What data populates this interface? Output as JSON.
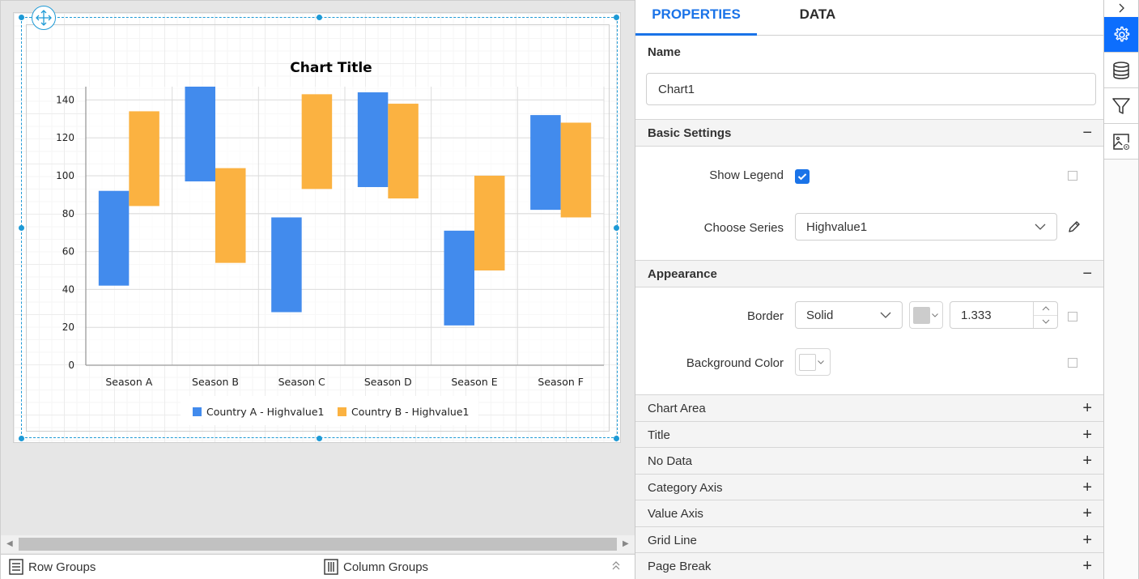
{
  "designer": {
    "scroll_left_icon": "caret-left-icon",
    "scroll_right_icon": "caret-right-icon",
    "groups": {
      "row_groups_label": "Row Groups",
      "column_groups_label": "Column Groups"
    }
  },
  "chart_data": {
    "type": "bar",
    "subtype": "range-column",
    "title": "Chart Title",
    "xlabel": "",
    "ylabel": "",
    "categories": [
      "Season A",
      "Season B",
      "Season C",
      "Season D",
      "Season E",
      "Season F"
    ],
    "ylim": [
      0,
      147
    ],
    "yticks": [
      0,
      20,
      40,
      60,
      80,
      100,
      120,
      140
    ],
    "grid": true,
    "legend_position": "bottom",
    "series": [
      {
        "name": "Country A - Highvalue1",
        "color": "#428bed",
        "low": [
          42,
          97,
          28,
          94,
          21,
          82
        ],
        "high": [
          92,
          147,
          78,
          144,
          71,
          132
        ]
      },
      {
        "name": "Country B - Highvalue1",
        "color": "#fbb241",
        "low": [
          84,
          54,
          93,
          88,
          50,
          78
        ],
        "high": [
          134,
          104,
          143,
          138,
          100,
          128
        ]
      }
    ]
  },
  "panel": {
    "tabs": [
      {
        "label": "PROPERTIES",
        "active": true
      },
      {
        "label": "DATA",
        "active": false
      }
    ],
    "name_label": "Name",
    "name_value": "Chart1",
    "basic_settings": {
      "title": "Basic Settings",
      "toggle": "−",
      "show_legend_label": "Show Legend",
      "show_legend_checked": true,
      "choose_series_label": "Choose Series",
      "choose_series_value": "Highvalue1"
    },
    "appearance": {
      "title": "Appearance",
      "toggle": "−",
      "border_label": "Border",
      "border_style": "Solid",
      "border_color": "#cccccc",
      "border_width": "1.333",
      "background_color_label": "Background Color",
      "background_color": "#ffffff"
    },
    "collapsed_sections": [
      {
        "title": "Chart Area",
        "toggle": "+"
      },
      {
        "title": "Title",
        "toggle": "+"
      },
      {
        "title": "No Data",
        "toggle": "+"
      },
      {
        "title": "Category Axis",
        "toggle": "+"
      },
      {
        "title": "Value Axis",
        "toggle": "+"
      },
      {
        "title": "Grid Line",
        "toggle": "+"
      },
      {
        "title": "Page Break",
        "toggle": "+"
      }
    ]
  },
  "rail": {
    "collapse_icon": "chevron-right-icon",
    "items": [
      {
        "icon": "gear-icon",
        "active": true
      },
      {
        "icon": "database-icon",
        "active": false
      },
      {
        "icon": "filter-icon",
        "active": false
      },
      {
        "icon": "image-settings-icon",
        "active": false
      }
    ]
  },
  "colors": {
    "accent": "#1a73e8",
    "rail_active": "#0d6efd",
    "selection": "#1e9ad6"
  }
}
